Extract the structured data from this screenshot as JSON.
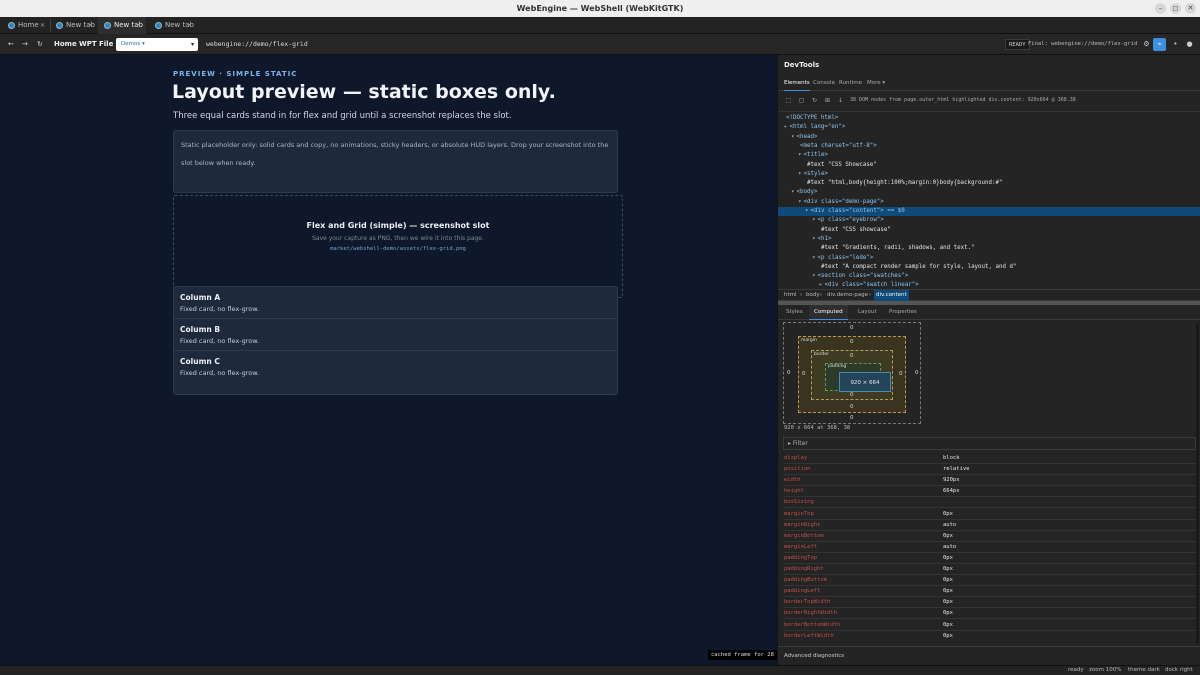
{
  "window": {
    "title": "WebEngine — WebShell (WebKitGTK)"
  },
  "tabs": [
    {
      "label": "Home"
    },
    {
      "label": "New tab"
    },
    {
      "label": "New tab"
    },
    {
      "label": "New tab"
    }
  ],
  "toolbar": {
    "back": "←",
    "forward": "→",
    "reload": "↻",
    "home_label": "Home",
    "wpt_label": "WPT",
    "file_label": "File",
    "demos_selected": "Demos ▾",
    "url": "webengine://demo/flex-grid",
    "status_badge": "READY",
    "final_url": "Final: webengine://demo/flex-grid"
  },
  "page": {
    "eyebrow": "PREVIEW · SIMPLE STATIC",
    "heading": "Layout preview — static boxes only.",
    "lede": "Three equal cards stand in for flex and grid until a screenshot replaces the slot.",
    "note": "Static placeholder only: solid cards and copy, no animations, sticky headers, or absolute HUD layers. Drop your screenshot into the slot below when ready.",
    "slot": {
      "title": "Flex and Grid (simple) — screenshot slot",
      "subtitle": "Save your capture as PNG, then we wire it into this page.",
      "path": "market/webshell-demo/assets/flex-grid.png"
    },
    "columns": [
      {
        "title": "Column A",
        "desc": "Fixed card, no flex-grow."
      },
      {
        "title": "Column B",
        "desc": "Fixed card, no flex-grow."
      },
      {
        "title": "Column C",
        "desc": "Fixed card, no flex-grow."
      }
    ],
    "cached": "cached frame for 28"
  },
  "devtools": {
    "title": "DevTools",
    "tabs": [
      "Elements",
      "Console",
      "Runtime",
      "More ▾"
    ],
    "info": "38 DOM nodes from page.outer_html  highlighted div.content: 920x664 @ 368.38",
    "dom_lines": [
      {
        "indent": 0,
        "arrow": "",
        "text": "<!DOCTYPE html>"
      },
      {
        "indent": 0,
        "arrow": "▸",
        "text": "<html lang=\"en\">"
      },
      {
        "indent": 1,
        "arrow": "▾",
        "text": "<head>"
      },
      {
        "indent": 2,
        "arrow": "",
        "text": "<meta charset=\"utf-8\">"
      },
      {
        "indent": 2,
        "arrow": "▾",
        "text": "<title>"
      },
      {
        "indent": 3,
        "arrow": "",
        "text": "#text \"CSS Showcase\""
      },
      {
        "indent": 2,
        "arrow": "▾",
        "text": "<style>"
      },
      {
        "indent": 3,
        "arrow": "",
        "text": "#text \"html,body{height:100%;margin:0}body{background:#\""
      },
      {
        "indent": 1,
        "arrow": "▾",
        "text": "<body>"
      },
      {
        "indent": 2,
        "arrow": "▾",
        "text": "<div class=\"demo-page\">"
      },
      {
        "indent": 3,
        "arrow": "▾",
        "text": "<div class=\"content\"> == $0"
      },
      {
        "indent": 4,
        "arrow": "▾",
        "text": "<p class=\"eyebrow\">"
      },
      {
        "indent": 5,
        "arrow": "",
        "text": "#text \"CSS showcase\""
      },
      {
        "indent": 4,
        "arrow": "▾",
        "text": "<h1>"
      },
      {
        "indent": 5,
        "arrow": "",
        "text": "#text \"Gradients, radii, shadows, and text.\""
      },
      {
        "indent": 4,
        "arrow": "▾",
        "text": "<p class=\"lede\">"
      },
      {
        "indent": 5,
        "arrow": "",
        "text": "#text \"A compact render sample for style, layout, and d\""
      },
      {
        "indent": 4,
        "arrow": "▾",
        "text": "<section class=\"swatches\">"
      },
      {
        "indent": 5,
        "arrow": "▸",
        "text": "<div class=\"swatch linear\">"
      }
    ],
    "crumbs": [
      "html",
      "body",
      "div.demo-page",
      "div.content"
    ],
    "panel_tabs": [
      "Styles",
      "Computed",
      "Layout",
      "Properties"
    ],
    "boxmodel": {
      "margin_label": "margin",
      "border_label": "border",
      "padding_label": "padding",
      "content": "920 × 664",
      "zero": "0",
      "summary": "920 x 664 at 368, 38"
    },
    "filter_label": "▸ Filter",
    "props": [
      {
        "name": "display",
        "value": "block"
      },
      {
        "name": "position",
        "value": "relative"
      },
      {
        "name": "width",
        "value": "920px"
      },
      {
        "name": "height",
        "value": "664px"
      },
      {
        "name": "boxSizing",
        "value": ""
      },
      {
        "name": "marginTop",
        "value": "0px"
      },
      {
        "name": "marginRight",
        "value": "auto"
      },
      {
        "name": "marginBottom",
        "value": "0px"
      },
      {
        "name": "marginLeft",
        "value": "auto"
      },
      {
        "name": "paddingTop",
        "value": "0px"
      },
      {
        "name": "paddingRight",
        "value": "0px"
      },
      {
        "name": "paddingBottom",
        "value": "0px"
      },
      {
        "name": "paddingLeft",
        "value": "0px"
      },
      {
        "name": "borderTopWidth",
        "value": "0px"
      },
      {
        "name": "borderRightWidth",
        "value": "0px"
      },
      {
        "name": "borderBottomWidth",
        "value": "0px"
      },
      {
        "name": "borderLeftWidth",
        "value": "0px"
      }
    ],
    "advanced_label": "Advanced diagnostics"
  },
  "statusbar": {
    "status": "ready",
    "zoom": "zoom 100%",
    "theme": "theme dark",
    "dock": "dock right"
  }
}
